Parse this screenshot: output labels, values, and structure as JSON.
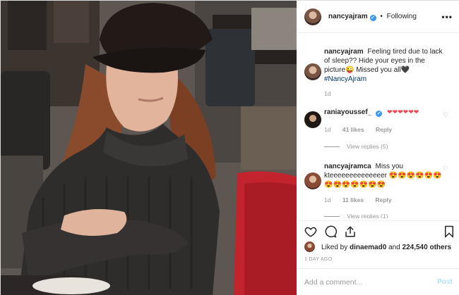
{
  "header": {
    "username": "nancyajram",
    "verified_mark": "✓",
    "separator": "•",
    "follow_status": "Following",
    "more_icon": "more-options-icon",
    "more_label": "•••"
  },
  "caption": {
    "username": "nancyajram",
    "text": "Feeling tired due to lack of sleep?? Hide your eyes in the picture😜 Missed you all🖤",
    "hashtag": "#NancyAjram",
    "age": "1d"
  },
  "comments": [
    {
      "username": "raniayoussef_",
      "verified_mark": "✓",
      "text": "❤❤❤❤❤❤",
      "age": "1d",
      "likes": "41 likes",
      "reply": "Reply",
      "view_replies": "View replies (5)"
    },
    {
      "username": "nancyajramca",
      "text": "Miss you kteeeeeeeeeeeeeer 😍😍😍😍😍😍😍😍😍😍😍😍😍",
      "age": "1d",
      "likes": "11 likes",
      "reply": "Reply",
      "view_replies": "View replies (1)"
    }
  ],
  "likes": {
    "prefix": "Liked by",
    "user": "dinaemad0",
    "middle": "and",
    "count": "224,540 others"
  },
  "timestamp": "1 DAY AGO",
  "add_comment": {
    "placeholder": "Add a comment...",
    "post_label": "Post"
  },
  "colors": {
    "verified": "#3897f0",
    "hashtag": "#003569",
    "post_disabled": "#b2dffc",
    "heart_red": "#ed4956"
  }
}
